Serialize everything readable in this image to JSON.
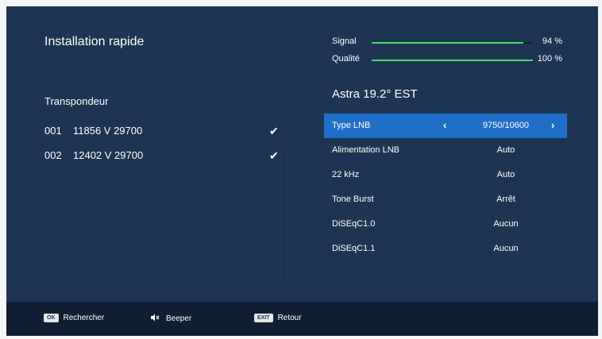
{
  "title": "Installation rapide",
  "transponders": {
    "label": "Transpondeur",
    "items": [
      {
        "num": "001",
        "freq": "11856 V 29700",
        "checked": true
      },
      {
        "num": "002",
        "freq": "12402 V 29700",
        "checked": true
      }
    ]
  },
  "meters": {
    "signal": {
      "label": "Signal",
      "value": "94 %",
      "level": 0.94
    },
    "quality": {
      "label": "Qualité",
      "value": "100 %",
      "level": 1.0
    }
  },
  "satellite": "Astra 19.2° EST",
  "settings": [
    {
      "name": "Type LNB",
      "value": "9750/10600",
      "selected": true
    },
    {
      "name": "Alimentation LNB",
      "value": "Auto"
    },
    {
      "name": "22 kHz",
      "value": "Auto"
    },
    {
      "name": "Tone Burst",
      "value": "Arrêt"
    },
    {
      "name": "DiSEqC1.0",
      "value": "Aucun"
    },
    {
      "name": "DiSEqC1.1",
      "value": "Aucun"
    }
  ],
  "footer": {
    "ok": {
      "key": "OK",
      "label": "Rechercher"
    },
    "beeper": {
      "icon": "speaker-mute-icon",
      "label": "Beeper"
    },
    "exit": {
      "key": "EXIT",
      "label": "Retour"
    }
  },
  "colors": {
    "background": "#1d3552",
    "selected": "#1f6fc8",
    "meter": "#4cd964",
    "footer": "#0f1e33"
  }
}
